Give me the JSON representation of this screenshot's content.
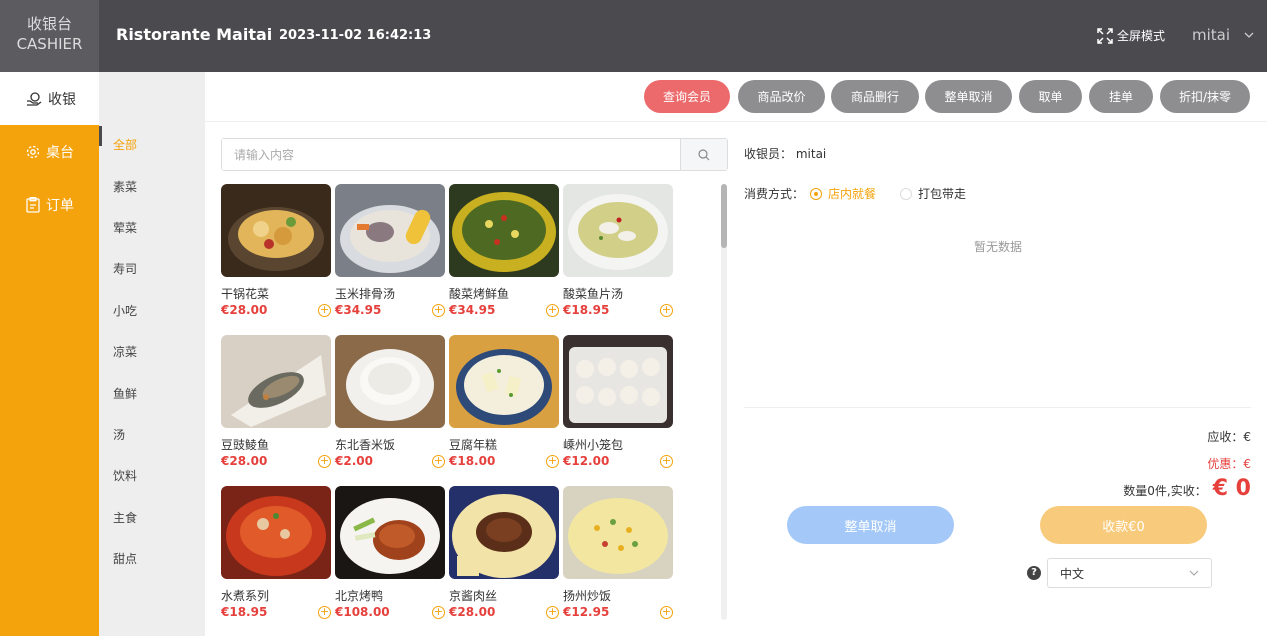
{
  "header": {
    "logo_line1": "收银台",
    "logo_line2": "CASHIER",
    "store_name": "Ristorante Maitai",
    "datetime": "2023-11-02 16:42:13",
    "fullscreen_label": "全屏模式",
    "username": "mitai"
  },
  "nav": [
    {
      "label": "收银",
      "icon": "cashier-icon"
    },
    {
      "label": "桌台",
      "icon": "gear-icon"
    },
    {
      "label": "订单",
      "icon": "clipboard-icon"
    }
  ],
  "categories": [
    "全部",
    "素菜",
    "荤菜",
    "寿司",
    "小吃",
    "凉菜",
    "鱼鲜",
    "汤",
    "饮料",
    "主食",
    "甜点"
  ],
  "toolbar": [
    "查询会员",
    "商品改价",
    "商品删行",
    "整单取消",
    "取单",
    "挂单",
    "折扣/抹零"
  ],
  "search": {
    "placeholder": "请输入内容"
  },
  "products": [
    {
      "name": "干锅花菜",
      "price": "€28.00"
    },
    {
      "name": "玉米排骨汤",
      "price": "€34.95"
    },
    {
      "name": "酸菜烤鲜鱼",
      "price": "€34.95"
    },
    {
      "name": "酸菜鱼片汤",
      "price": "€18.95"
    },
    {
      "name": "豆豉鲮鱼",
      "price": "€28.00"
    },
    {
      "name": "东北香米饭",
      "price": "€2.00"
    },
    {
      "name": "豆腐年糕",
      "price": "€18.00"
    },
    {
      "name": "嵊州小笼包",
      "price": "€12.00"
    },
    {
      "name": "水煮系列",
      "price": "€18.95"
    },
    {
      "name": "北京烤鸭",
      "price": "€108.00"
    },
    {
      "name": "京酱肉丝",
      "price": "€28.00"
    },
    {
      "name": "扬州炒饭",
      "price": "€12.95"
    }
  ],
  "order": {
    "cashier_label": "收银员：",
    "cashier_name": "mitai",
    "mode_label": "消费方式：",
    "mode_dine_in": "店内就餐",
    "mode_takeaway": "打包带走",
    "empty_text": "暂无数据",
    "due_label": "应收：€",
    "discount_label": "优惠：€",
    "total_label": "数量0件,实收：",
    "total_amount": "€ 0",
    "cancel_label": "整单取消",
    "pay_label": "收款€0",
    "help": "?",
    "language": "中文"
  },
  "colors": {
    "accent": "#f5a30c",
    "header": "#4a4a4f",
    "price": "#e6403c",
    "primary_btn": "#ec6a6c"
  }
}
